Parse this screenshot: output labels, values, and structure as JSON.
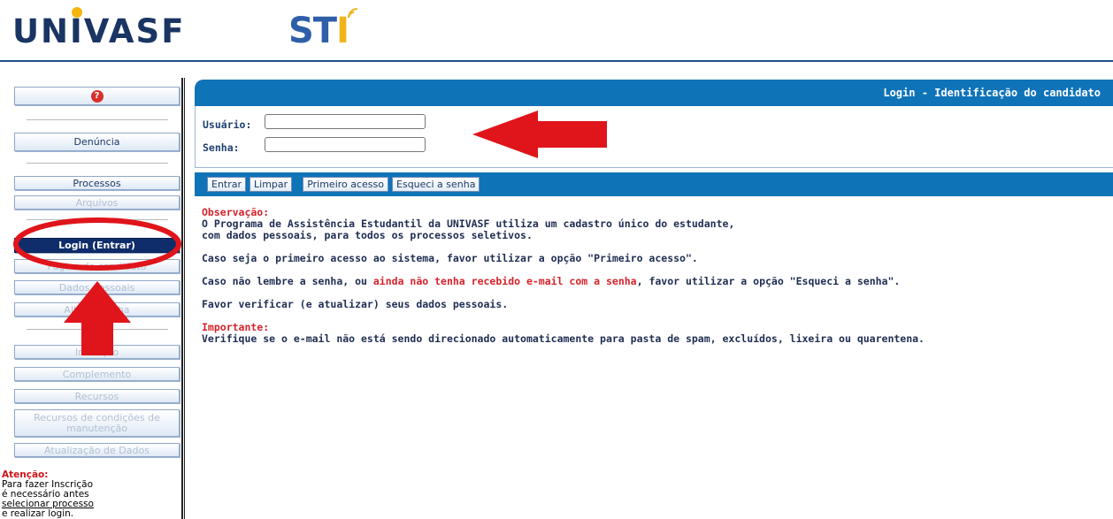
{
  "header": {
    "logo_left": "UNIVASF",
    "logo_right": "STI"
  },
  "sidebar": {
    "help_icon": "question-icon",
    "items": [
      {
        "label": "Denúncia",
        "state": "enabled"
      },
      {
        "label": "Processos",
        "state": "enabled"
      },
      {
        "label": "Arquivos",
        "state": "disabled"
      },
      {
        "label": "Login (Entrar)",
        "state": "active"
      },
      {
        "label": "Página do candidato",
        "state": "disabled"
      },
      {
        "label": "Dados pessoais",
        "state": "disabled"
      },
      {
        "label": "Alterar senha",
        "state": "disabled"
      },
      {
        "label": "Inscrição",
        "state": "disabled"
      },
      {
        "label": "Complemento",
        "state": "disabled"
      },
      {
        "label": "Recursos",
        "state": "disabled"
      },
      {
        "label": "Recursos de condições de manutenção",
        "state": "disabled"
      },
      {
        "label": "Atualização de Dados",
        "state": "disabled"
      }
    ],
    "attention": {
      "title": "Atenção:",
      "line1": "Para fazer Inscrição",
      "line2": "é necessário antes",
      "link": "selecionar processo",
      "line4": "e realizar login."
    }
  },
  "main": {
    "title": "Login - Identificação do candidato",
    "form": {
      "user_label": "Usuário:",
      "user_value": "",
      "password_label": "Senha:",
      "password_value": ""
    },
    "actions": {
      "enter": "Entrar",
      "clear": "Limpar",
      "first_access": "Primeiro acesso",
      "forgot": "Esqueci a senha"
    },
    "content": {
      "obs_title": "Observação:",
      "obs_line1": "O Programa de Assistência Estudantil da UNIVASF utiliza um cadastro único do estudante,",
      "obs_line2": "com dados pessoais, para todos os processos seletivos.",
      "p_first_access": "Caso seja o primeiro acesso ao sistema, favor utilizar a opção \"Primeiro acesso\".",
      "p_forgot_a": "Caso não lembre a senha, ou ",
      "p_forgot_red": "ainda não tenha recebido e-mail com a senha",
      "p_forgot_b": ", favor utilizar a opção \"Esqueci a senha\".",
      "p_verify": "Favor verificar (e atualizar) seus dados pessoais.",
      "imp_title": "Importante:",
      "imp_line": "Verifique se o e-mail não está sendo direcionado automaticamente para pasta de spam, excluídos, lixeira ou quarentena."
    }
  },
  "colors": {
    "primary_blue": "#0f73b8",
    "active_nav": "#0f2d6b",
    "accent_red": "#d5232b",
    "annotation_red": "#e0141b"
  }
}
